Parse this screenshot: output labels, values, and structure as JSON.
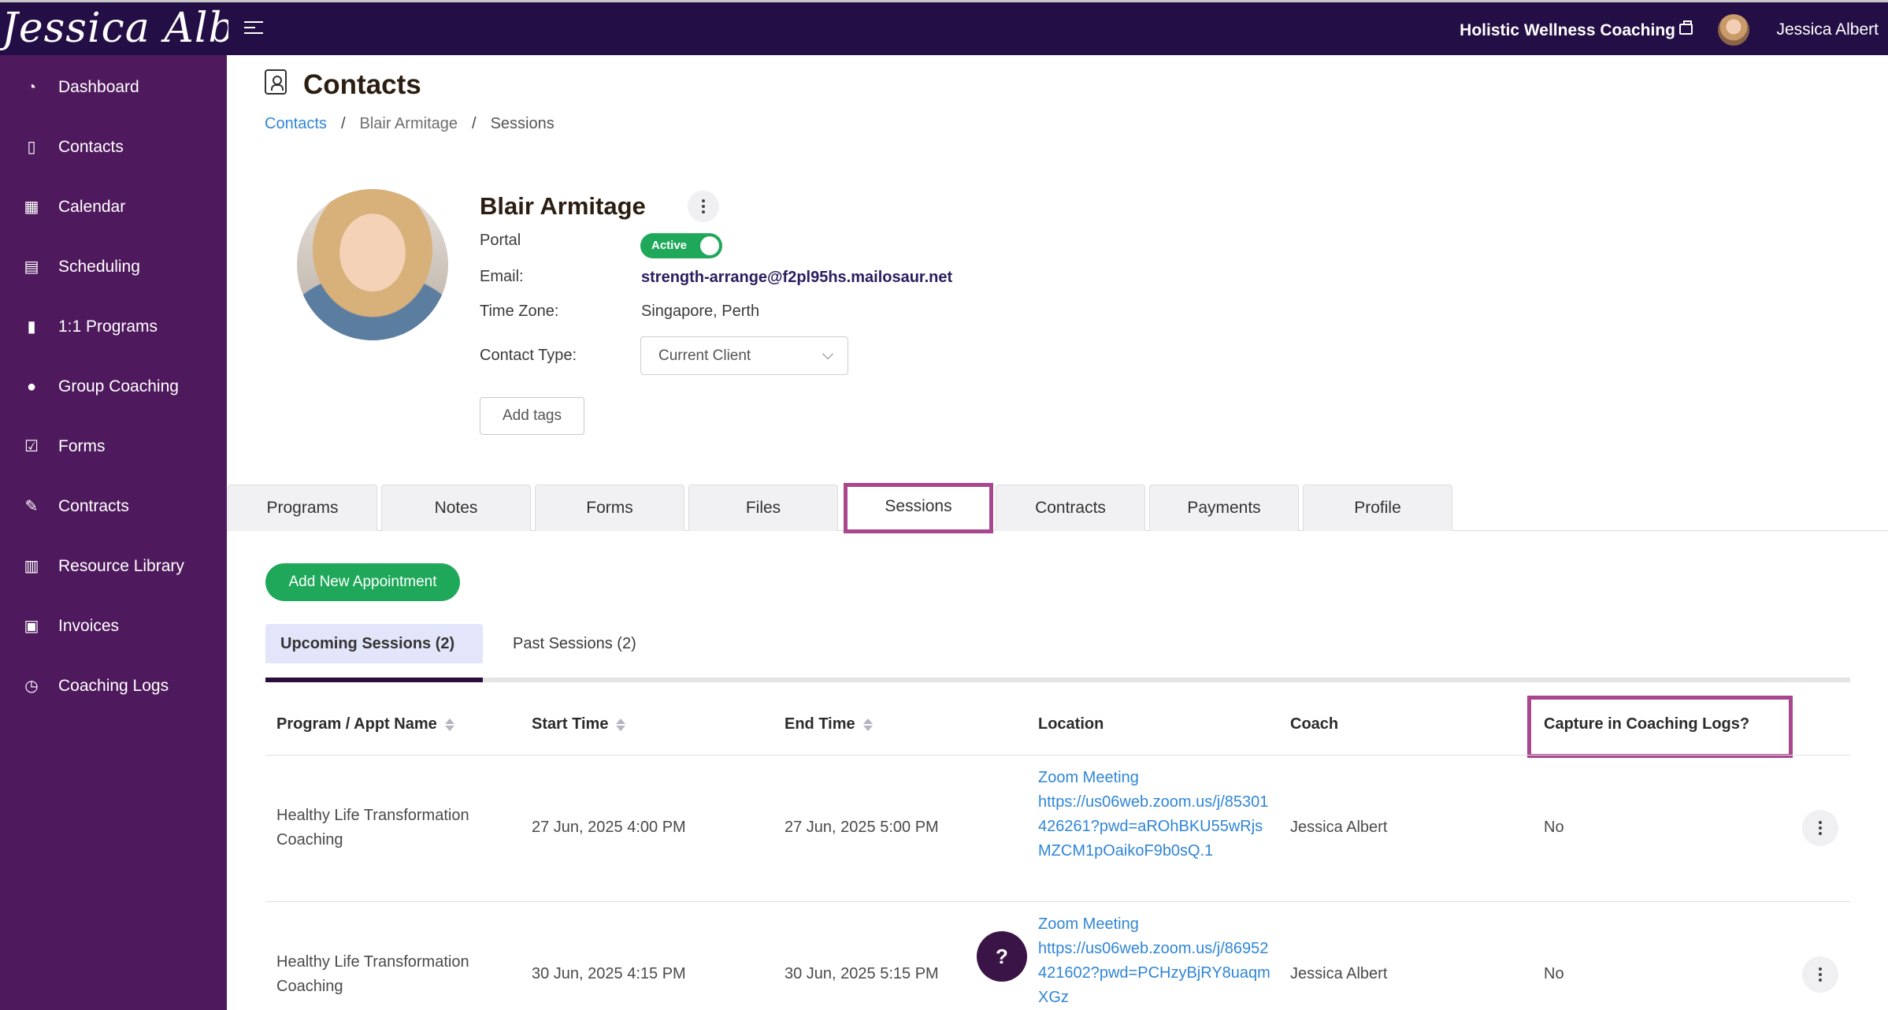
{
  "topbar": {
    "brand": "Jessica Albert",
    "business_name": "Holistic Wellness Coaching",
    "user_name": "Jessica Albert"
  },
  "sidebar": {
    "items": [
      {
        "label": "Dashboard",
        "icon": "dashboard-icon"
      },
      {
        "label": "Contacts",
        "icon": "contacts-icon"
      },
      {
        "label": "Calendar",
        "icon": "calendar-icon"
      },
      {
        "label": "Scheduling",
        "icon": "scheduling-icon"
      },
      {
        "label": "1:1 Programs",
        "icon": "book-icon"
      },
      {
        "label": "Group Coaching",
        "icon": "group-icon"
      },
      {
        "label": "Forms",
        "icon": "checklist-icon"
      },
      {
        "label": "Contracts",
        "icon": "signature-icon"
      },
      {
        "label": "Resource Library",
        "icon": "library-icon"
      },
      {
        "label": "Invoices",
        "icon": "invoice-icon"
      },
      {
        "label": "Coaching Logs",
        "icon": "clock-icon"
      }
    ]
  },
  "page": {
    "title": "Contacts",
    "breadcrumb": [
      "Contacts",
      "Blair Armitage",
      "Sessions"
    ]
  },
  "contact": {
    "name": "Blair Armitage",
    "portal_label": "Portal",
    "portal_status": "Active",
    "email_label": "Email:",
    "email": "strength-arrange@f2pl95hs.mailosaur.net",
    "timezone_label": "Time Zone:",
    "timezone": "Singapore, Perth",
    "contact_type_label": "Contact Type:",
    "contact_type": "Current Client",
    "add_tags": "Add tags"
  },
  "tabs": [
    "Programs",
    "Notes",
    "Forms",
    "Files",
    "Sessions",
    "Contracts",
    "Payments",
    "Profile"
  ],
  "active_tab": "Sessions",
  "sessions": {
    "add_button": "Add New Appointment",
    "subtabs": [
      "Upcoming Sessions (2)",
      "Past Sessions (2)"
    ],
    "columns": [
      "Program / Appt Name",
      "Start Time",
      "End Time",
      "Location",
      "Coach",
      "Capture in Coaching Logs?"
    ],
    "rows": [
      {
        "name": "Healthy Life Transformation Coaching",
        "start": "27 Jun, 2025 4:00 PM",
        "end": "27 Jun, 2025 5:00 PM",
        "location_title": "Zoom Meeting",
        "location_url": "https://us06web.zoom.us/j/85301426261?pwd=aROhBKU55wRjsMZCM1pOaikoF9b0sQ.1",
        "coach": "Jessica Albert",
        "capture": "No"
      },
      {
        "name": "Healthy Life Transformation Coaching",
        "start": "30 Jun, 2025 4:15 PM",
        "end": "30 Jun, 2025 5:15 PM",
        "location_title": "Zoom Meeting",
        "location_url": "https://us06web.zoom.us/j/86952421602?pwd=PCHzyBjRY8uaqmXGz",
        "coach": "Jessica Albert",
        "capture": "No"
      }
    ]
  },
  "help": "?"
}
